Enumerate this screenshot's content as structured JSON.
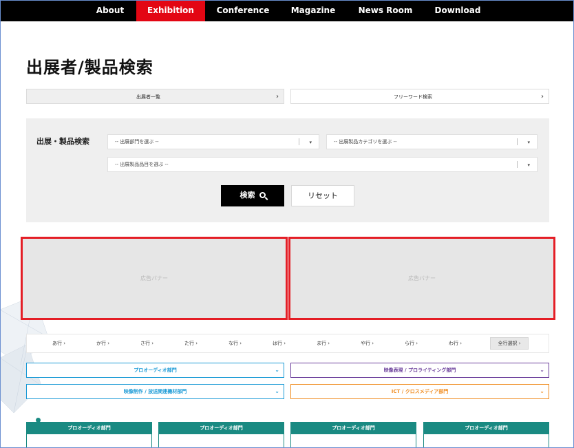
{
  "nav": {
    "items": [
      "About",
      "Exhibition",
      "Conference",
      "Magazine",
      "News Room",
      "Download"
    ]
  },
  "page_title": "出展者/製品検索",
  "quicklinks": [
    {
      "label": "出展者一覧",
      "arrow": "›"
    },
    {
      "label": "フリーワード検索",
      "arrow": "›"
    }
  ],
  "search": {
    "label": "出展・製品検索",
    "select_division": "-- 出展部門を選ぶ --",
    "select_category": "-- 出展製品カテゴリを選ぶ --",
    "select_item": "-- 出展製品品目を選ぶ --",
    "caret": "▾",
    "search_button": "検索",
    "reset_button": "リセット"
  },
  "banners": [
    "広告バナー",
    "広告バナー"
  ],
  "kana": {
    "items": [
      "あ行 ›",
      "か行 ›",
      "さ行 ›",
      "た行 ›",
      "な行 ›",
      "は行 ›",
      "ま行 ›",
      "や行 ›",
      "ら行 ›",
      "わ行 ›"
    ],
    "all_label": "全行選択 ›"
  },
  "categories": [
    {
      "label": "プロオーディオ部門",
      "caret": "⌄",
      "color": "#1a9ad6"
    },
    {
      "label": "映像表現 / プロライティング部門",
      "caret": "⌄",
      "color": "#6a3d9a"
    },
    {
      "label": "映像制作 / 放送関連機材部門",
      "caret": "⌄",
      "color": "#1a9ad6"
    },
    {
      "label": "ICT / クロスメディア部門",
      "caret": "⌄",
      "color": "#f08a1c"
    }
  ],
  "cards": [
    "プロオーディオ部門",
    "プロオーディオ部門",
    "プロオーディオ部門",
    "プロオーディオ部門"
  ],
  "colors": {
    "nav_active": "#e30613",
    "banner_border": "#e41e26",
    "card_teal": "#1a8a82"
  }
}
